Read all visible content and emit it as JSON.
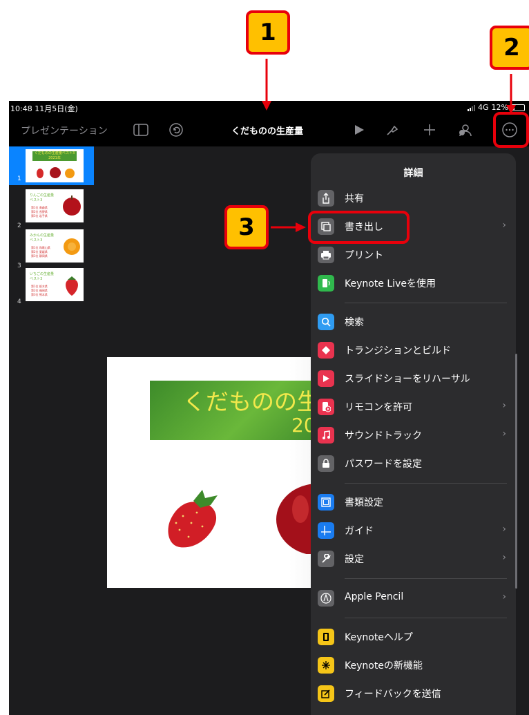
{
  "status": {
    "time": "10:48",
    "date": "11月5日(金)",
    "network": "4G",
    "battery": "12%"
  },
  "toolbar": {
    "presentations": "プレゼンテーション",
    "title": "くだものの生産量"
  },
  "slides": [
    {
      "num": "1",
      "title": "くだものの生産量ベスト3",
      "year": "2021年"
    },
    {
      "num": "2",
      "title": "りんごの生産量ベスト3",
      "lines": [
        "第1位 青森県",
        "第2位 長野県",
        "第3位 岩手県"
      ]
    },
    {
      "num": "3",
      "title": "みかんの生産量ベスト3",
      "lines": [
        "第1位 和歌山県",
        "第2位 愛媛県",
        "第3位 静岡県"
      ]
    },
    {
      "num": "4",
      "title": "いちごの生産量ベスト3",
      "lines": [
        "第1位 栃木県",
        "第2位 福岡県",
        "第3位 熊本県"
      ]
    }
  ],
  "slide_main": {
    "title_visible": "くだものの生",
    "year_visible": "202"
  },
  "menu": {
    "title": "詳細",
    "items": [
      {
        "label": "共有",
        "icon": "share-icon",
        "color": "#636366",
        "chev": ""
      },
      {
        "label": "書き出し",
        "icon": "export-icon",
        "color": "#636366",
        "chev": "›"
      },
      {
        "label": "プリント",
        "icon": "print-icon",
        "color": "#636366",
        "chev": ""
      },
      {
        "label": "Keynote Liveを使用",
        "icon": "keynote-live-icon",
        "color": "#30b94d",
        "chev": ""
      },
      {
        "label": "検索",
        "icon": "search-icon",
        "color": "#2f9cf2",
        "chev": ""
      },
      {
        "label": "トランジションとビルド",
        "icon": "transition-icon",
        "color": "#e9334f",
        "chev": ""
      },
      {
        "label": "スライドショーをリハーサル",
        "icon": "rehearse-icon",
        "color": "#e9334f",
        "chev": ""
      },
      {
        "label": "リモコンを許可",
        "icon": "remote-icon",
        "color": "#e9334f",
        "chev": "›"
      },
      {
        "label": "サウンドトラック",
        "icon": "music-icon",
        "color": "#e9334f",
        "chev": "›"
      },
      {
        "label": "パスワードを設定",
        "icon": "lock-icon",
        "color": "#636366",
        "chev": ""
      },
      {
        "label": "書類設定",
        "icon": "document-setup-icon",
        "color": "#1a7cf0",
        "chev": ""
      },
      {
        "label": "ガイド",
        "icon": "guides-icon",
        "color": "#1a7cf0",
        "chev": "›"
      },
      {
        "label": "設定",
        "icon": "wrench-icon",
        "color": "#636366",
        "chev": "›"
      },
      {
        "label": "Apple Pencil",
        "icon": "pencil-icon",
        "color": "#636366",
        "chev": "›"
      },
      {
        "label": "Keynoteヘルプ",
        "icon": "help-book-icon",
        "color": "#f5c518",
        "chev": ""
      },
      {
        "label": "Keynoteの新機能",
        "icon": "whats-new-icon",
        "color": "#f5c518",
        "chev": ""
      },
      {
        "label": "フィードバックを送信",
        "icon": "feedback-icon",
        "color": "#f5c518",
        "chev": ""
      }
    ]
  },
  "callouts": [
    "1",
    "2",
    "3"
  ]
}
